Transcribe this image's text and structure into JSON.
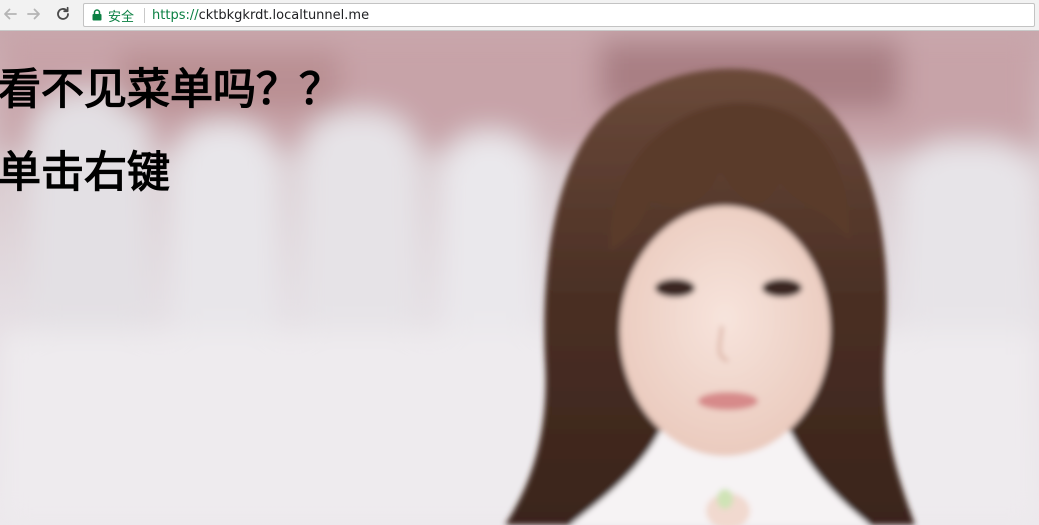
{
  "browser": {
    "secure_label": "安全",
    "url_scheme": "https://",
    "url_host": "cktbkgkrdt.localtunnel.me",
    "icons": {
      "back": "arrow-left-icon",
      "forward": "arrow-right-icon",
      "reload": "reload-icon",
      "lock": "lock-icon"
    },
    "colors": {
      "secure_green": "#0b8043"
    }
  },
  "page": {
    "headline_1": "看不见菜单吗？？",
    "headline_2": "单击右键"
  }
}
